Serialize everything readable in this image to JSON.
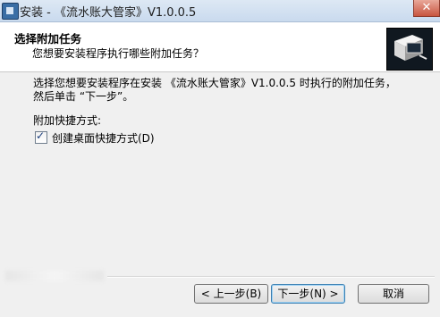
{
  "window": {
    "title": "安装 - 《流水账大管家》V1.0.0.5",
    "close_glyph": "✕"
  },
  "header": {
    "title": "选择附加任务",
    "subtitle": "您想要安装程序执行哪些附加任务？",
    "image_icon": "computer-box-icon"
  },
  "body": {
    "description_line1": "选择您想要安装程序在安装 《流水账大管家》V1.0.0.5 时执行的附加任务，",
    "description_line2": "然后单击 “下一步”。",
    "group_label": "附加快捷方式:",
    "tasks": [
      {
        "label": "创建桌面快捷方式(D)",
        "checked": true,
        "check_glyph": "✓"
      }
    ]
  },
  "footer": {
    "back_label": "< 上一步(B)",
    "next_label": "下一步(N) >",
    "cancel_label": "取消"
  },
  "colors": {
    "titlebar": "#c9daee",
    "header_bg": "#ffffff",
    "window_bg": "#f0f0f0",
    "close_button": "#c8553f"
  }
}
